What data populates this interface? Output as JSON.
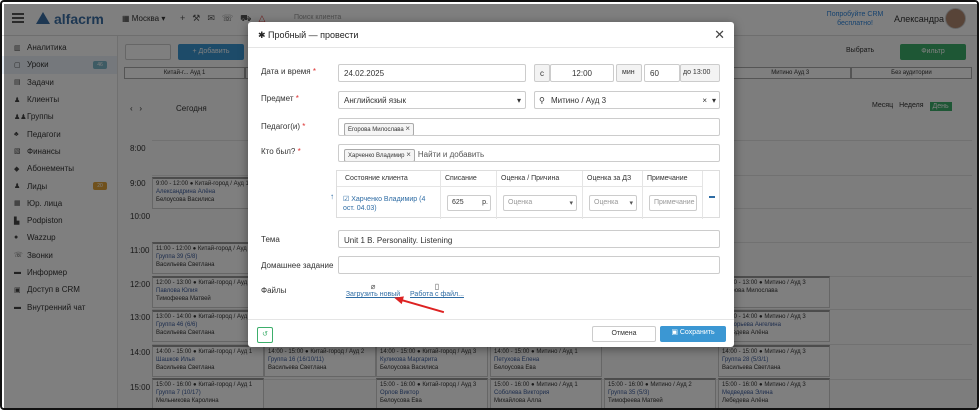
{
  "topbar": {
    "logo": "alfacrm",
    "branch": "Москва",
    "search_placeholder": "Поиск клиента",
    "promo": "Попробуйте CRM бесплатно!",
    "user_name": "Александра"
  },
  "sidebar": {
    "items": [
      {
        "label": "Аналитика",
        "icon": "chart-icon"
      },
      {
        "label": "Уроки",
        "icon": "calendar-icon",
        "badge": "46",
        "active": true
      },
      {
        "label": "Задачи",
        "icon": "tasks-icon"
      },
      {
        "label": "Клиенты",
        "icon": "person-icon"
      },
      {
        "label": "Группы",
        "icon": "group-icon"
      },
      {
        "label": "Педагоги",
        "icon": "teacher-icon"
      },
      {
        "label": "Финансы",
        "icon": "money-icon"
      },
      {
        "label": "Абонементы",
        "icon": "ticket-icon"
      },
      {
        "label": "Лиды",
        "icon": "lead-icon",
        "badge": "20"
      },
      {
        "label": "Юр. лица",
        "icon": "building-icon"
      },
      {
        "label": "Podpiston",
        "icon": "doc-icon"
      },
      {
        "label": "Wazzup",
        "icon": "chat-icon"
      },
      {
        "label": "Звонки",
        "icon": "phone-icon"
      },
      {
        "label": "Информер",
        "icon": "info-icon"
      },
      {
        "label": "Доступ в CRM",
        "icon": "lock-icon"
      },
      {
        "label": "Внутренний чат",
        "icon": "message-icon"
      }
    ]
  },
  "calendar": {
    "add_label": "+ Добавить",
    "today_label": "Сегодня",
    "filter_label": "Фильтр",
    "select_label": "Выбрать",
    "views": [
      "Месяц",
      "Неделя",
      "День"
    ],
    "rooms": [
      "Китай-г... Ауд 1",
      "",
      "",
      "",
      "",
      "Митино Ауд 3",
      "Без аудитории"
    ],
    "hours": [
      "8:00",
      "9:00",
      "10:00",
      "11:00",
      "12:00",
      "13:00",
      "14:00",
      "15:00"
    ],
    "events": [
      {
        "time": "9:00 - 12:00 ● Китай-город / Ауд 1",
        "title": "Александрина Алёна",
        "teacher": "Белоусова Василиса"
      },
      {
        "time": "11:00 - 12:00 ● Китай-город / Ауд 1",
        "title": "Группа 39 (5/8)",
        "teacher": "Васильева Светлана"
      },
      {
        "time": "12:00 - 13:00 ● Китай-город / Ауд 1",
        "title": "Павлова Юлия",
        "teacher": "Тимофеева Матвей"
      },
      {
        "time": "13:00 - 14:00 ● Китай-город / Ауд 1",
        "title": "Группа 46 (6/6)",
        "teacher": "Васильева Светлана"
      },
      {
        "time": "14:00 - 15:00 ● Китай-город / Ауд 1",
        "title": "Шашков Илья",
        "teacher": "Васильева Светлана"
      },
      {
        "time": "15:00 - 16:00 ● Китай-город / Ауд 1",
        "title": "Группа 7 (10/17)",
        "teacher": "Мельникова Каролина"
      },
      {
        "time": "14:00 - 15:00 ● Китай-город / Ауд 2",
        "title": "Группа 16 (16/10/11)",
        "teacher": "Васильева Светлана"
      },
      {
        "time": "14:00 - 15:00 ● Китай-город / Ауд 3",
        "title": "Куликова Маргарита",
        "teacher": "Белоусова Василиса"
      },
      {
        "time": "15:00 - 16:00 ● Китай-город / Ауд 3",
        "title": "Орлов Виктор",
        "teacher": "Белоусова Ева"
      },
      {
        "time": "14:00 - 15:00 ● Митино / Ауд 1",
        "title": "Петухова Елена",
        "teacher": "Белоусова Ева"
      },
      {
        "time": "15:00 - 16:00 ● Митино / Ауд 1",
        "title": "Соболева Виктория",
        "teacher": "Михайлова Алла"
      },
      {
        "time": "15:00 - 16:00 ● Митино / Ауд 2",
        "title": "Группа 35 (5/3)",
        "teacher": "Тимофеева Матвей"
      },
      {
        "time": "12:00 - 13:00 ● Митино / Ауд 3",
        "title": "",
        "teacher": "Егорова Милослава"
      },
      {
        "time": "13:00 - 14:00 ● Митино / Ауд 3",
        "title": "Григорьева Ангелина",
        "teacher": "Лебедева Алёна"
      },
      {
        "time": "14:00 - 15:00 ● Митино / Ауд 3",
        "title": "Группа 28 (5/3/1)",
        "teacher": "Васильева Светлана"
      },
      {
        "time": "15:00 - 16:00 ● Митино / Ауд 3",
        "title": "Медведева Элина",
        "teacher": "Лебедева Алёна"
      }
    ]
  },
  "modal": {
    "title": "Пробный — провести",
    "datetime_label": "Дата и время",
    "date": "24.02.2025",
    "from_label": "с",
    "time": "12:00",
    "minutes_label": "мин",
    "duration": "60",
    "until": "до 13:00",
    "subject_label": "Предмет",
    "subject": "Английский язык",
    "room": "Митино / Ауд 3",
    "teachers_label": "Педагог(и)",
    "teacher_tag": "Егорова Милослава",
    "attendees_label": "Кто был?",
    "attendee_tag": "Харченко Владимир",
    "attendee_placeholder": "Найти и добавить",
    "table_headers": [
      "Состояние клиента",
      "Списание",
      "Оценка / Причина",
      "Оценка за ДЗ",
      "Примечание"
    ],
    "client_name": "Харченко Владимир (4 ост. 04.03)",
    "charge": "625",
    "currency": "р.",
    "grade_placeholder": "Оценка",
    "hw_grade_placeholder": "Оценка",
    "note_placeholder": "Примечание",
    "topic_label": "Тема",
    "topic": "Unit 1 B. Personality. Listening",
    "homework_label": "Домашнее задание",
    "files_label": "Файлы",
    "upload_label": "Загрузить новый",
    "workfile_label": "Работа с файл...",
    "cancel_label": "Отмена",
    "save_label": "Сохранить",
    "colors": {
      "primary": "#3b97d3",
      "success": "#3dae6b",
      "danger": "#d22",
      "link": "#2e6ca4"
    }
  }
}
